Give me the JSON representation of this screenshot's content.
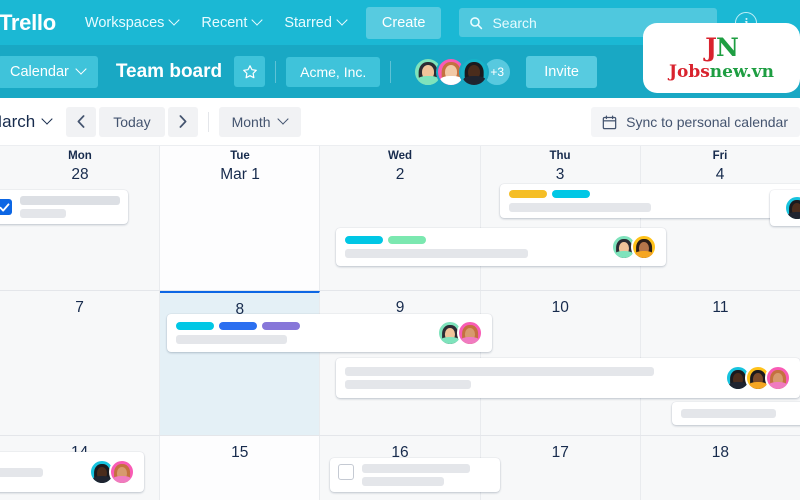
{
  "topnav": {
    "brand": "Trello",
    "items": [
      {
        "label": "Workspaces",
        "icon": "chevron-down-icon"
      },
      {
        "label": "Recent",
        "icon": "chevron-down-icon"
      },
      {
        "label": "Starred",
        "icon": "chevron-down-icon"
      }
    ],
    "create_label": "Create",
    "search_placeholder": "Search",
    "search_icon": "search-icon",
    "info_label": "i"
  },
  "boardbar": {
    "view_label": "Calendar",
    "board_title": "Team board",
    "star_icon": "star-icon",
    "workspace_label": "Acme, Inc.",
    "members": [
      {
        "name": "member-1",
        "hair": "#2B2B33",
        "skin": "#F0C39A",
        "body": "#7FE3BC",
        "bg": "#7FE3BC"
      },
      {
        "name": "member-2",
        "hair": "#C4713F",
        "skin": "#F2C9A6",
        "body": "#FFFFFF",
        "bg": "#F95BB5"
      },
      {
        "name": "member-3",
        "hair": "#1A1A1E",
        "skin": "#4A2C1C",
        "body": "#1F2430",
        "bg": "#17B3C9"
      }
    ],
    "more_count": "+3",
    "invite_label": "Invite"
  },
  "caltoolbar": {
    "month_label": "March",
    "prev_icon": "chevron-left-icon",
    "next_icon": "chevron-right-icon",
    "today_label": "Today",
    "view_label": "Month",
    "sync_label": "Sync to personal calendar",
    "sync_icon": "calendar-icon"
  },
  "calendar": {
    "day_headers": [
      {
        "dow": "Mon",
        "num": "28"
      },
      {
        "dow": "Tue",
        "num": "Mar 1"
      },
      {
        "dow": "Wed",
        "num": "2"
      },
      {
        "dow": "Thu",
        "num": "3"
      },
      {
        "dow": "Fri",
        "num": "4"
      }
    ],
    "week2": [
      "7",
      "8",
      "9",
      "10",
      "11"
    ],
    "week3": [
      "14",
      "15",
      "16",
      "17",
      "18"
    ],
    "today": "8",
    "colors": {
      "label_cyan": "#00C7E5",
      "label_green": "#7BE8B0",
      "label_yellow": "#F5BE26",
      "label_blue": "#2B6FF0",
      "label_purple": "#8777D9",
      "today_bg": "#E4F0F6",
      "today_border": "#0C66E4",
      "grid_bg": "#F7F8F9",
      "nav_bg": "#1BB8D4",
      "board_bg": "#19A8C4"
    },
    "cards": [
      {
        "name": "card-mon28-checked",
        "checkbox": "checked",
        "labels": [],
        "lines": [
          1,
          2
        ],
        "avatars": []
      },
      {
        "name": "card-thu3-top",
        "checkbox": "none",
        "labels": [
          "#F5BE26",
          "#00C7E5"
        ],
        "lines": [
          1
        ],
        "avatars": []
      },
      {
        "name": "card-wed2-span",
        "checkbox": "none",
        "labels": [
          "#00C7E5",
          "#7BE8B0"
        ],
        "lines": [
          1
        ],
        "avatars": [
          {
            "name": "member-4",
            "hair": "#2B2B33",
            "skin": "#F0C39A",
            "body": "#7FE3BC",
            "bg": "#7FE3BC"
          },
          {
            "name": "member-5",
            "hair": "#2B1E18",
            "skin": "#B5764A",
            "body": "#F5A623",
            "bg": "#FFC21A"
          }
        ]
      },
      {
        "name": "card-day8-span",
        "checkbox": "none",
        "labels": [
          "#00C7E5",
          "#2B6FF0",
          "#8777D9"
        ],
        "lines": [
          1
        ],
        "avatars": [
          {
            "name": "member-6",
            "hair": "#2B2B33",
            "skin": "#F0C39A",
            "body": "#7FE3BC",
            "bg": "#7FE3BC"
          },
          {
            "name": "member-7",
            "hair": "#C4713F",
            "skin": "#D79A6E",
            "body": "#F07BC0",
            "bg": "#F95BB5"
          }
        ]
      },
      {
        "name": "card-day9-span",
        "checkbox": "none",
        "labels": [],
        "lines": [
          1,
          2
        ],
        "avatars": [
          {
            "name": "member-8",
            "hair": "#1A1A1E",
            "skin": "#4A2C1C",
            "body": "#1F2430",
            "bg": "#17C3DE"
          },
          {
            "name": "member-9",
            "hair": "#1A1A1E",
            "skin": "#7A4A2A",
            "body": "#F5A623",
            "bg": "#FFC21A"
          },
          {
            "name": "member-10",
            "hair": "#C4713F",
            "skin": "#D79A6E",
            "body": "#F07BC0",
            "bg": "#F95BB5"
          }
        ]
      },
      {
        "name": "card-day11-bottom",
        "checkbox": "none",
        "labels": [],
        "lines": [
          1
        ],
        "avatars": []
      },
      {
        "name": "card-day14-span",
        "checkbox": "none",
        "labels": [],
        "lines": [
          1
        ],
        "avatars": [
          {
            "name": "member-11",
            "hair": "#1A1A1E",
            "skin": "#4A2C1C",
            "body": "#1F2430",
            "bg": "#17C3DE"
          },
          {
            "name": "member-12",
            "hair": "#C4713F",
            "skin": "#D79A6E",
            "body": "#F07BC0",
            "bg": "#F95BB5"
          }
        ]
      },
      {
        "name": "card-day16-unchecked",
        "checkbox": "unchecked",
        "labels": [],
        "lines": [
          1,
          2
        ],
        "avatars": []
      },
      {
        "name": "card-fri4-edge",
        "checkbox": "none",
        "labels": [],
        "lines": [],
        "avatars": [
          {
            "name": "member-13",
            "hair": "#1A1A1E",
            "skin": "#4A2C1C",
            "body": "#1F2430",
            "bg": "#17C3DE"
          }
        ]
      }
    ]
  },
  "watermark": {
    "mark_j": "J",
    "mark_n": "N",
    "text_red": "Jobs",
    "text_green": "new.vn"
  }
}
